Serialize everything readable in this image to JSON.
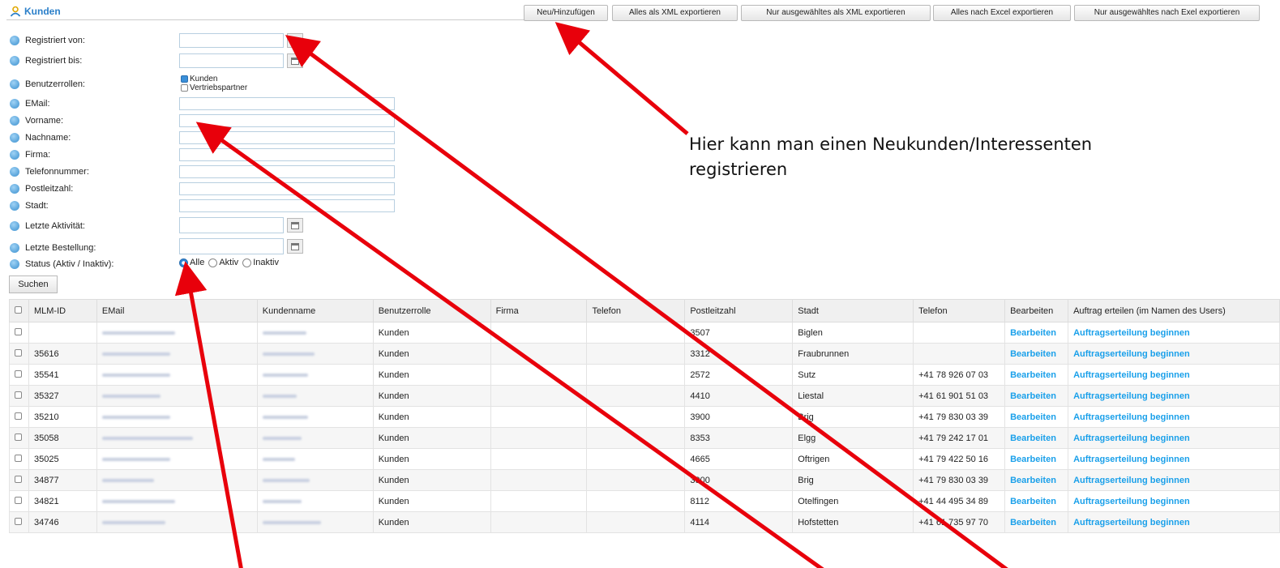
{
  "header": {
    "title": "Kunden",
    "title_icon": "user-icon"
  },
  "toolbar": {
    "buttons": [
      "Neu/Hinzufügen",
      "Alles als XML exportieren",
      "Nur ausgewähltes als XML exportieren",
      "Alles nach Excel exportieren",
      "Nur ausgewähltes nach Exel exportieren"
    ]
  },
  "filters": {
    "registriert_von": "Registriert von:",
    "registriert_bis": "Registriert bis:",
    "benutzerrollen": "Benutzerrollen:",
    "role_kunden": "Kunden",
    "role_vertrieb": "Vertriebspartner",
    "email": "EMail:",
    "vorname": "Vorname:",
    "nachname": "Nachname:",
    "firma": "Firma:",
    "telefonnummer": "Telefonnummer:",
    "postleitzahl": "Postleitzahl:",
    "stadt": "Stadt:",
    "letzte_aktivitaet": "Letzte Aktivität:",
    "letzte_bestellung": "Letzte Bestellung:",
    "status": "Status (Aktiv / Inaktiv):",
    "status_alle": "Alle",
    "status_aktiv": "Aktiv",
    "status_inaktiv": "Inaktiv",
    "search_button": "Suchen"
  },
  "table": {
    "headers": [
      "MLM-ID",
      "EMail",
      "Kundenname",
      "Benutzerrolle",
      "Firma",
      "Telefon",
      "Postleitzahl",
      "Stadt",
      "Telefon",
      "Bearbeiten",
      "Auftrag erteilen (im Namen des Users)"
    ],
    "rows": [
      {
        "id": "",
        "role": "Kunden",
        "plz": "3507",
        "stadt": "Biglen",
        "tel": "",
        "edit": "Bearbeiten",
        "order": "Auftragserteilung beginnen"
      },
      {
        "id": "35616",
        "role": "Kunden",
        "plz": "3312",
        "stadt": "Fraubrunnen",
        "tel": "",
        "edit": "Bearbeiten",
        "order": "Auftragserteilung beginnen"
      },
      {
        "id": "35541",
        "role": "Kunden",
        "plz": "2572",
        "stadt": "Sutz",
        "tel": "+41 78 926 07 03",
        "edit": "Bearbeiten",
        "order": "Auftragserteilung beginnen"
      },
      {
        "id": "35327",
        "role": "Kunden",
        "plz": "4410",
        "stadt": "Liestal",
        "tel": "+41 61 901 51 03",
        "edit": "Bearbeiten",
        "order": "Auftragserteilung beginnen"
      },
      {
        "id": "35210",
        "role": "Kunden",
        "plz": "3900",
        "stadt": "Brig",
        "tel": "+41 79 830 03 39",
        "edit": "Bearbeiten",
        "order": "Auftragserteilung beginnen"
      },
      {
        "id": "35058",
        "role": "Kunden",
        "plz": "8353",
        "stadt": "Elgg",
        "tel": "+41 79 242 17 01",
        "edit": "Bearbeiten",
        "order": "Auftragserteilung beginnen"
      },
      {
        "id": "35025",
        "role": "Kunden",
        "plz": "4665",
        "stadt": "Oftrigen",
        "tel": "+41 79 422 50 16",
        "edit": "Bearbeiten",
        "order": "Auftragserteilung beginnen"
      },
      {
        "id": "34877",
        "role": "Kunden",
        "plz": "3900",
        "stadt": "Brig",
        "tel": "+41 79 830 03 39",
        "edit": "Bearbeiten",
        "order": "Auftragserteilung beginnen"
      },
      {
        "id": "34821",
        "role": "Kunden",
        "plz": "8112",
        "stadt": "Otelfingen",
        "tel": "+41 44 495 34 89",
        "edit": "Bearbeiten",
        "order": "Auftragserteilung beginnen"
      },
      {
        "id": "34746",
        "role": "Kunden",
        "plz": "4114",
        "stadt": "Hofstetten",
        "tel": "+41 61 735 97 70",
        "edit": "Bearbeiten",
        "order": "Auftragserteilung beginnen"
      }
    ]
  },
  "annotation": {
    "line1": "Hier kann man einen Neukunden/Interessenten",
    "line2": "registrieren",
    "arrow_color": "#e8000b"
  }
}
